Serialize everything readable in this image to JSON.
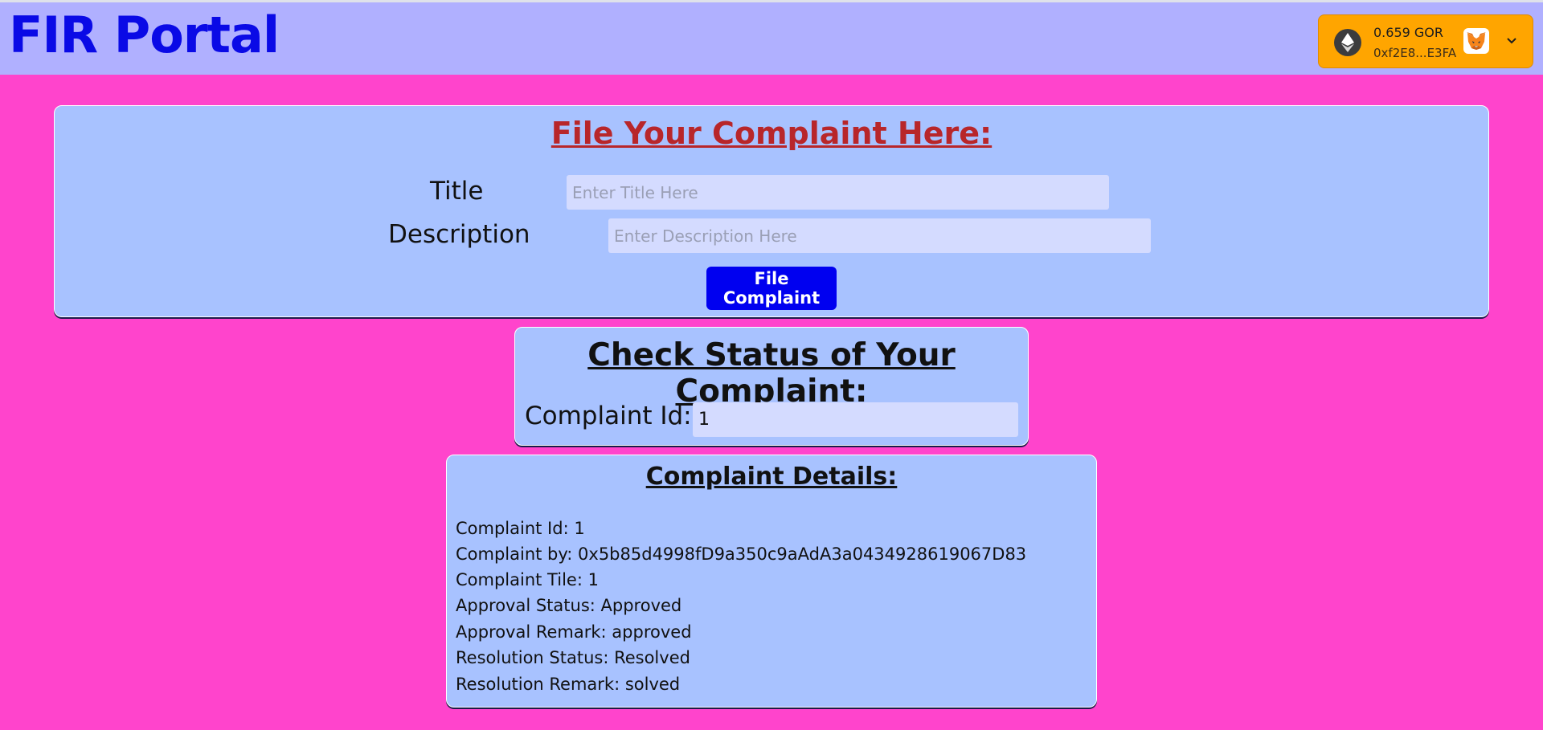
{
  "header": {
    "title": "FIR Portal"
  },
  "wallet": {
    "balance": "0.659 GOR",
    "address": "0xf2E8...E3FA",
    "token_icon": "ethereum-icon",
    "account_icon": "metamask-fox-icon"
  },
  "file_complaint": {
    "heading": "File Your Complaint Here:",
    "title_label": "Title",
    "title_placeholder": "Enter Title Here",
    "title_value": "",
    "description_label": "Description",
    "description_placeholder": "Enter Description Here",
    "description_value": "",
    "button_label": "File Complaint"
  },
  "check_status": {
    "heading": "Check Status of Your Complaint:",
    "id_label": "Complaint Id:",
    "id_value": "1"
  },
  "details": {
    "heading": "Complaint Details:",
    "lines": [
      "Complaint Id: 1",
      "Complaint by: 0x5b85d4998fD9a350c9aAdA3a0434928619067D83",
      "Complaint Tile: 1",
      "Approval Status: Approved",
      "Approval Remark: approved",
      "Resolution Status: Resolved",
      "Resolution Remark: solved"
    ]
  },
  "colors": {
    "page_background": "#ff44cc",
    "header_background": "#b0b0ff",
    "brand": "#0a0ae6",
    "panel_background": "#a8c2ff",
    "file_heading": "#b8262a",
    "primary_button": "#0000f0",
    "wallet_background": "#ffa500"
  }
}
